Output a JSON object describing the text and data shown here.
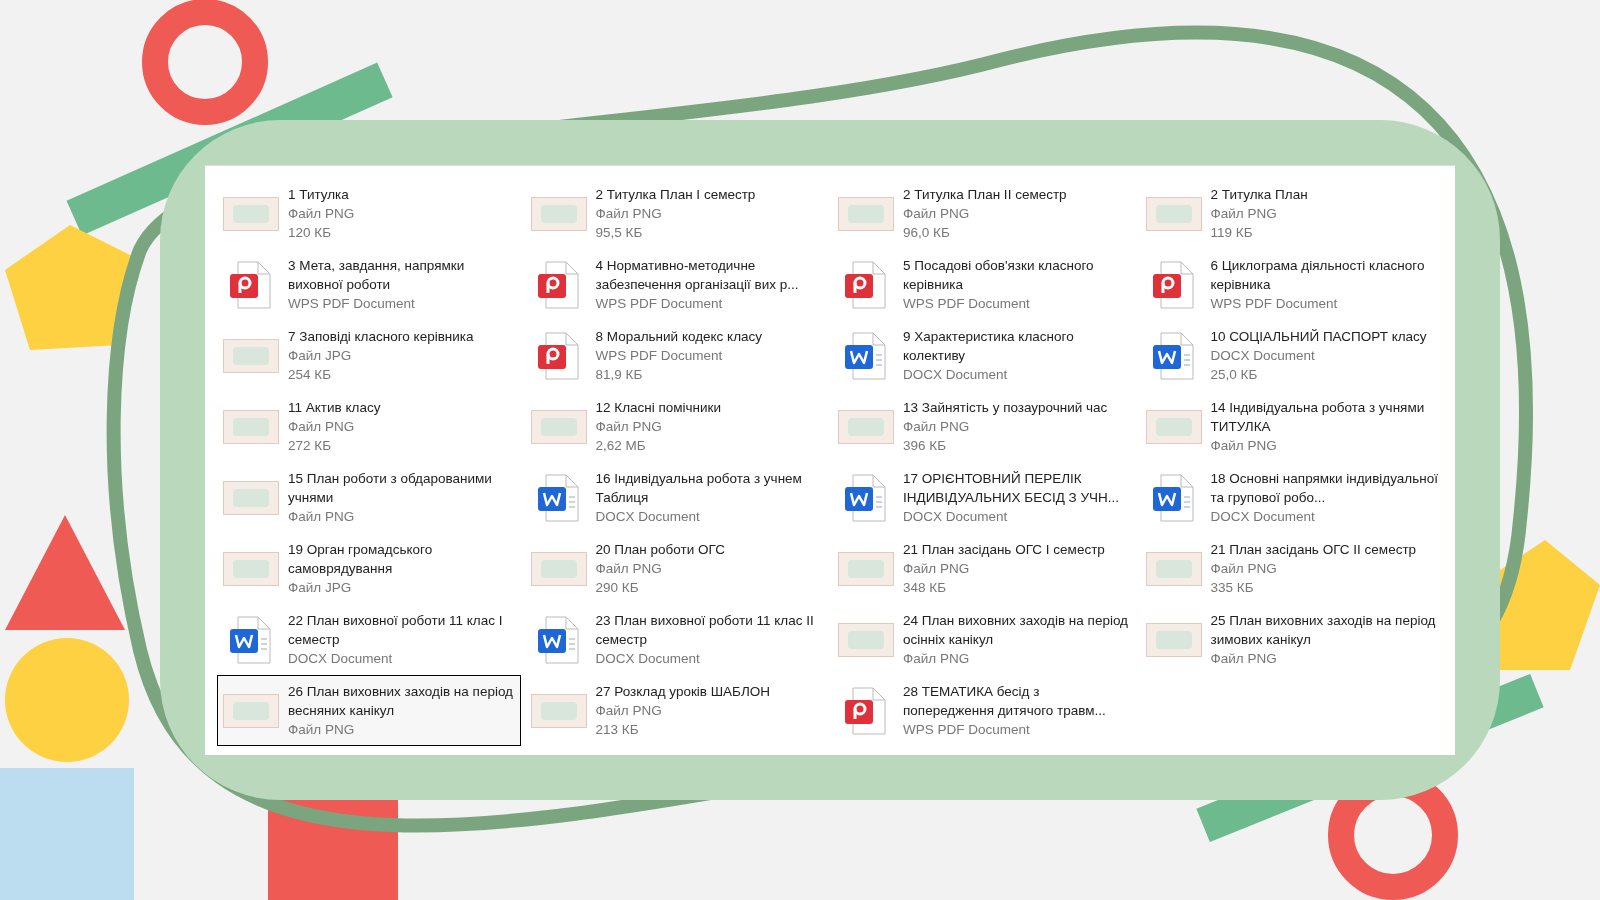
{
  "files": [
    {
      "name": "1 Титулка",
      "type": "Файл PNG",
      "size": "120 КБ",
      "kind": "image",
      "selected": false
    },
    {
      "name": "2 Титулка План I семестр",
      "type": "Файл PNG",
      "size": "95,5 КБ",
      "kind": "image",
      "selected": false
    },
    {
      "name": "2 Титулка План II семестр",
      "type": "Файл PNG",
      "size": "96,0 КБ",
      "kind": "image",
      "selected": false
    },
    {
      "name": "2 Титулка План",
      "type": "Файл PNG",
      "size": "119 КБ",
      "kind": "image",
      "selected": false
    },
    {
      "name": "3 Мета, завдання, напрямки виховної роботи",
      "type": "WPS PDF Document",
      "kind": "pdf",
      "selected": false
    },
    {
      "name": "4 Нормативно-методичне забезпечення організації вих р...",
      "type": "WPS PDF Document",
      "kind": "pdf",
      "selected": false
    },
    {
      "name": "5 Посадові обов'язки класного керівника",
      "type": "WPS PDF Document",
      "kind": "pdf",
      "selected": false
    },
    {
      "name": "6 Циклограма діяльності класного керівника",
      "type": "WPS PDF Document",
      "kind": "pdf",
      "selected": false
    },
    {
      "name": "7 Заповіді класного керівника",
      "type": "Файл JPG",
      "size": "254 КБ",
      "kind": "image",
      "selected": false
    },
    {
      "name": "8 Моральний кодекс класу",
      "type": "WPS PDF Document",
      "size": "81,9 КБ",
      "kind": "pdf",
      "selected": false
    },
    {
      "name": "9 Характеристика класного колективу",
      "type": "DOCX Document",
      "kind": "docx",
      "selected": false
    },
    {
      "name": "10 СОЦІАЛЬНИЙ ПАСПОРТ класу",
      "type": "DOCX Document",
      "size": "25,0 КБ",
      "kind": "docx",
      "selected": false
    },
    {
      "name": "11 Актив класу",
      "type": "Файл PNG",
      "size": "272 КБ",
      "kind": "image",
      "selected": false
    },
    {
      "name": "12 Класні помічники",
      "type": "Файл PNG",
      "size": "2,62 МБ",
      "kind": "image",
      "selected": false
    },
    {
      "name": "13 Зайнятість у позаурочний час",
      "type": "Файл PNG",
      "size": "396 КБ",
      "kind": "image",
      "selected": false
    },
    {
      "name": "14 Індивідуальна робота з учнями ТИТУЛКА",
      "type": "Файл PNG",
      "kind": "image",
      "selected": false
    },
    {
      "name": "15 План роботи з обдарованими учнями",
      "type": "Файл PNG",
      "kind": "image",
      "selected": false
    },
    {
      "name": "16 Індивідуальна робота з учнем Таблиця",
      "type": "DOCX Document",
      "kind": "docx",
      "selected": false
    },
    {
      "name": "17 ОРІЄНТОВНИЙ ПЕРЕЛІК ІНДИВІДУАЛЬНИХ БЕСІД З УЧН...",
      "type": "DOCX Document",
      "kind": "docx",
      "selected": false
    },
    {
      "name": "18 Основні напрямки індивідуальної та групової робо...",
      "type": "DOCX Document",
      "kind": "docx",
      "selected": false
    },
    {
      "name": "19 Орган громадського самоврядування",
      "type": "Файл JPG",
      "kind": "image",
      "selected": false
    },
    {
      "name": "20 План роботи ОГС",
      "type": "Файл PNG",
      "size": "290 КБ",
      "kind": "image",
      "selected": false
    },
    {
      "name": "21 План засідань ОГС I семестр",
      "type": "Файл PNG",
      "size": "348 КБ",
      "kind": "image",
      "selected": false
    },
    {
      "name": "21 План засідань ОГС II семестр",
      "type": "Файл PNG",
      "size": "335 КБ",
      "kind": "image",
      "selected": false
    },
    {
      "name": "22 План виховної роботи 11 клас I семестр",
      "type": "DOCX Document",
      "kind": "docx",
      "selected": false
    },
    {
      "name": "23 План виховної роботи 11 клас II семестр",
      "type": "DOCX Document",
      "kind": "docx",
      "selected": false
    },
    {
      "name": "24 План виховних заходів на період осінніх канікул",
      "type": "Файл PNG",
      "kind": "image",
      "selected": false
    },
    {
      "name": "25 План виховних заходів на період зимових канікул",
      "type": "Файл PNG",
      "kind": "image",
      "selected": false
    },
    {
      "name": "26 План виховних заходів на період весняних канікул",
      "type": "Файл PNG",
      "kind": "image",
      "selected": true
    },
    {
      "name": "27 Розклад уроків ШАБЛОН",
      "type": "Файл PNG",
      "size": "213 КБ",
      "kind": "image",
      "selected": false
    },
    {
      "name": "28 ТЕМАТИКА  бесід з попередження  дитячого травм...",
      "type": "WPS PDF Document",
      "kind": "pdf",
      "selected": false
    }
  ]
}
